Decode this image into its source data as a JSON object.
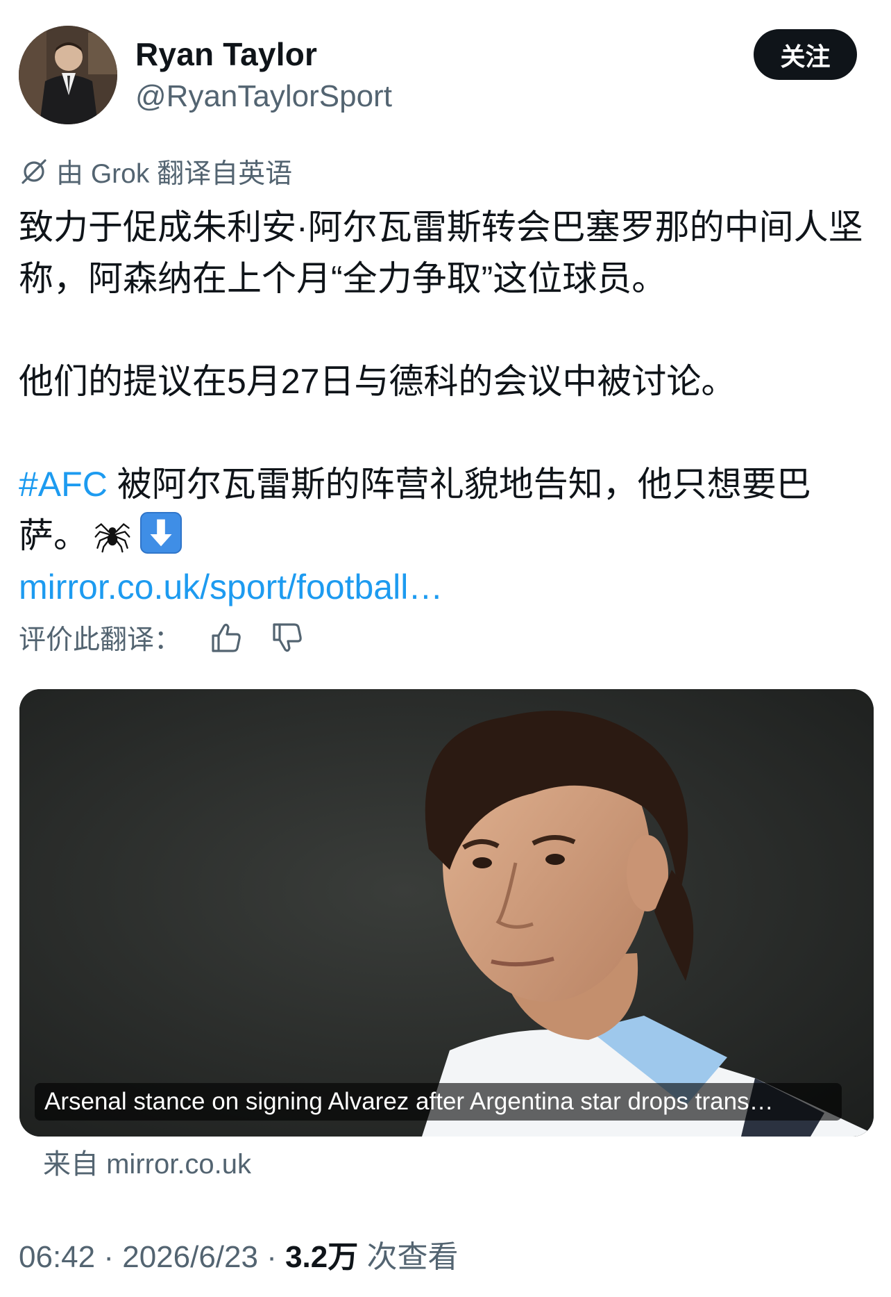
{
  "author": {
    "display_name": "Ryan Taylor",
    "handle": "@RyanTaylorSport",
    "follow_label": "关注"
  },
  "translation": {
    "note": "由 Grok 翻译自英语",
    "rate_label": "评价此翻译："
  },
  "tweet": {
    "para1": "致力于促成朱利安·阿尔瓦雷斯转会巴塞罗那的中间人坚称，阿森纳在上个月“全力争取”这位球员。",
    "para2": "他们的提议在5月27日与德科的会议中被讨论。",
    "hashtag": "#AFC",
    "para3": " 被阿尔瓦雷斯的阵营礼貌地告知，他只想要巴萨。",
    "link": "mirror.co.uk/sport/football…"
  },
  "card": {
    "caption": "Arsenal stance on signing Alvarez after Argentina star drops trans…",
    "source": "来自 mirror.co.uk"
  },
  "meta": {
    "time": "06:42",
    "separator": " · ",
    "date": "2026/6/23",
    "views_count": "3.2万",
    "views_label": " 次查看"
  },
  "icons": {
    "translate": "grok-translate-icon",
    "spider": "spider-emoji-icon",
    "arrow": "down-arrow-emoji-icon",
    "like": "thumbs-up-icon",
    "dislike": "thumbs-down-icon"
  },
  "colors": {
    "accent": "#1d9bf0",
    "text": "#0f1419",
    "secondary": "#536471",
    "follow_bg": "#0f1419"
  }
}
